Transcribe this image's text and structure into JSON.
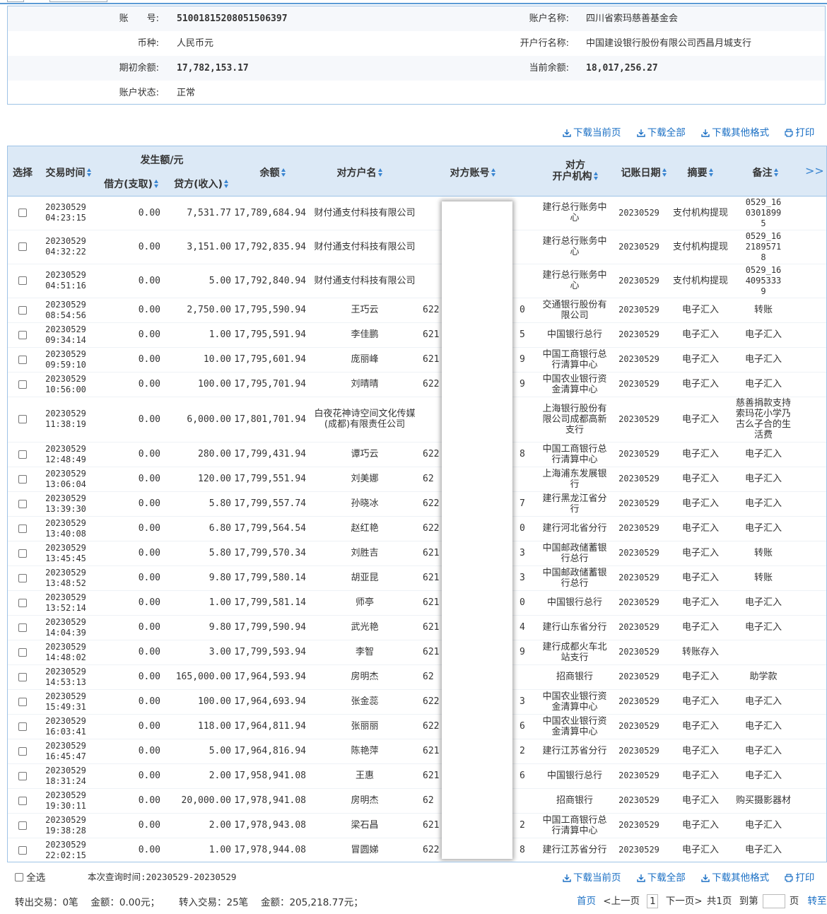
{
  "account": {
    "account_no_label": "账　　号:",
    "account_no": "51001815208051506397",
    "account_name_label": "账户名称:",
    "account_name": "四川省索玛慈善基金会",
    "currency_label": "币种:",
    "currency": "人民币元",
    "bank_label": "开户行名称:",
    "bank": "中国建设银行股份有限公司西昌月城支行",
    "opening_balance_label": "期初余额:",
    "opening_balance": "17,782,153.17",
    "current_balance_label": "当前余额:",
    "current_balance": "18,017,256.27",
    "status_label": "账户状态:",
    "status": "正常"
  },
  "toolbar": {
    "download_current": "下载当前页",
    "download_all": "下载全部",
    "download_other": "下载其他格式",
    "print": "打印"
  },
  "table": {
    "headers": {
      "select": "选择",
      "time": "交易时间",
      "amount_group": "发生额/元",
      "debit": "借方(支取)",
      "credit": "贷方(收入)",
      "balance": "余额",
      "counterparty_name": "对方户名",
      "counterparty_account": "对方账号",
      "counterparty_bank_l1": "对方",
      "counterparty_bank_l2": "开户机构",
      "post_date": "记账日期",
      "summary": "摘要",
      "remark": "备注",
      "more": ">>"
    },
    "rows": [
      {
        "date": "20230529",
        "time": "04:23:15",
        "debit": "0.00",
        "credit": "7,531.77",
        "balance": "17,789,684.94",
        "name": "财付通支付科技有限公司",
        "acct_l": "",
        "acct_r": "",
        "bank": "建行总行账务中心",
        "post": "20230529",
        "summary": "支付机构提现",
        "remark": "0529_1603018995"
      },
      {
        "date": "20230529",
        "time": "04:32:22",
        "debit": "0.00",
        "credit": "3,151.00",
        "balance": "17,792,835.94",
        "name": "财付通支付科技有限公司",
        "acct_l": "",
        "acct_r": "",
        "bank": "建行总行账务中心",
        "post": "20230529",
        "summary": "支付机构提现",
        "remark": "0529_1621895718"
      },
      {
        "date": "20230529",
        "time": "04:51:16",
        "debit": "0.00",
        "credit": "5.00",
        "balance": "17,792,840.94",
        "name": "财付通支付科技有限公司",
        "acct_l": "",
        "acct_r": "",
        "bank": "建行总行账务中心",
        "post": "20230529",
        "summary": "支付机构提现",
        "remark": "0529_1640953339"
      },
      {
        "date": "20230529",
        "time": "08:54:56",
        "debit": "0.00",
        "credit": "2,750.00",
        "balance": "17,795,590.94",
        "name": "王巧云",
        "acct_l": "622",
        "acct_r": "0",
        "bank": "交通银行股份有限公司",
        "post": "20230529",
        "summary": "电子汇入",
        "remark": "转账"
      },
      {
        "date": "20230529",
        "time": "09:34:14",
        "debit": "0.00",
        "credit": "1.00",
        "balance": "17,795,591.94",
        "name": "李佳鹏",
        "acct_l": "621",
        "acct_r": "5",
        "bank": "中国银行总行",
        "post": "20230529",
        "summary": "电子汇入",
        "remark": "电子汇入"
      },
      {
        "date": "20230529",
        "time": "09:59:10",
        "debit": "0.00",
        "credit": "10.00",
        "balance": "17,795,601.94",
        "name": "庞丽峰",
        "acct_l": "621",
        "acct_r": "9",
        "bank": "中国工商银行总行清算中心",
        "post": "20230529",
        "summary": "电子汇入",
        "remark": "电子汇入"
      },
      {
        "date": "20230529",
        "time": "10:56:00",
        "debit": "0.00",
        "credit": "100.00",
        "balance": "17,795,701.94",
        "name": "刘晴晴",
        "acct_l": "622",
        "acct_r": "9",
        "bank": "中国农业银行资金清算中心",
        "post": "20230529",
        "summary": "电子汇入",
        "remark": "电子汇入"
      },
      {
        "date": "20230529",
        "time": "11:38:19",
        "debit": "0.00",
        "credit": "6,000.00",
        "balance": "17,801,701.94",
        "name": "白夜花神诗空间文化传媒(成都)有限责任公司",
        "acct_l": "",
        "acct_r": "",
        "bank": "上海银行股份有限公司成都高新支行",
        "post": "20230529",
        "summary": "电子汇入",
        "remark": "慈善捐款支持索玛花小学乃古么子合的生活费"
      },
      {
        "date": "20230529",
        "time": "12:48:49",
        "debit": "0.00",
        "credit": "280.00",
        "balance": "17,799,431.94",
        "name": "谭巧云",
        "acct_l": "622",
        "acct_r": "8",
        "bank": "中国工商银行总行清算中心",
        "post": "20230529",
        "summary": "电子汇入",
        "remark": "电子汇入"
      },
      {
        "date": "20230529",
        "time": "13:06:04",
        "debit": "0.00",
        "credit": "120.00",
        "balance": "17,799,551.94",
        "name": "刘美娜",
        "acct_l": "62",
        "acct_r": "",
        "bank": "上海浦东发展银行",
        "post": "20230529",
        "summary": "电子汇入",
        "remark": "电子汇入"
      },
      {
        "date": "20230529",
        "time": "13:39:30",
        "debit": "0.00",
        "credit": "5.80",
        "balance": "17,799,557.74",
        "name": "孙晓冰",
        "acct_l": "622",
        "acct_r": "7",
        "bank": "建行黑龙江省分行",
        "post": "20230529",
        "summary": "电子汇入",
        "remark": "电子汇入"
      },
      {
        "date": "20230529",
        "time": "13:40:08",
        "debit": "0.00",
        "credit": "6.80",
        "balance": "17,799,564.54",
        "name": "赵红艳",
        "acct_l": "622",
        "acct_r": "0",
        "bank": "建行河北省分行",
        "post": "20230529",
        "summary": "电子汇入",
        "remark": "电子汇入"
      },
      {
        "date": "20230529",
        "time": "13:45:45",
        "debit": "0.00",
        "credit": "5.80",
        "balance": "17,799,570.34",
        "name": "刘胜吉",
        "acct_l": "621",
        "acct_r": "3",
        "bank": "中国邮政储蓄银行总行",
        "post": "20230529",
        "summary": "电子汇入",
        "remark": "转账"
      },
      {
        "date": "20230529",
        "time": "13:48:52",
        "debit": "0.00",
        "credit": "9.80",
        "balance": "17,799,580.14",
        "name": "胡亚昆",
        "acct_l": "621",
        "acct_r": "3",
        "bank": "中国邮政储蓄银行总行",
        "post": "20230529",
        "summary": "电子汇入",
        "remark": "转账"
      },
      {
        "date": "20230529",
        "time": "13:52:14",
        "debit": "0.00",
        "credit": "1.00",
        "balance": "17,799,581.14",
        "name": "师亭",
        "acct_l": "621",
        "acct_r": "0",
        "bank": "中国银行总行",
        "post": "20230529",
        "summary": "电子汇入",
        "remark": "电子汇入"
      },
      {
        "date": "20230529",
        "time": "14:04:39",
        "debit": "0.00",
        "credit": "9.80",
        "balance": "17,799,590.94",
        "name": "武光艳",
        "acct_l": "621",
        "acct_r": "4",
        "bank": "建行山东省分行",
        "post": "20230529",
        "summary": "电子汇入",
        "remark": "电子汇入"
      },
      {
        "date": "20230529",
        "time": "14:48:02",
        "debit": "0.00",
        "credit": "3.00",
        "balance": "17,799,593.94",
        "name": "李智",
        "acct_l": "621",
        "acct_r": "9",
        "bank": "建行成都火车北站支行",
        "post": "20230529",
        "summary": "转账存入",
        "remark": ""
      },
      {
        "date": "20230529",
        "time": "14:53:13",
        "debit": "0.00",
        "credit": "165,000.00",
        "balance": "17,964,593.94",
        "name": "房明杰",
        "acct_l": "62",
        "acct_r": "",
        "bank": "招商银行",
        "post": "20230529",
        "summary": "电子汇入",
        "remark": "助学款"
      },
      {
        "date": "20230529",
        "time": "15:49:31",
        "debit": "0.00",
        "credit": "100.00",
        "balance": "17,964,693.94",
        "name": "张金蕊",
        "acct_l": "622",
        "acct_r": "3",
        "bank": "中国农业银行资金清算中心",
        "post": "20230529",
        "summary": "电子汇入",
        "remark": "电子汇入"
      },
      {
        "date": "20230529",
        "time": "16:03:41",
        "debit": "0.00",
        "credit": "118.00",
        "balance": "17,964,811.94",
        "name": "张丽丽",
        "acct_l": "622",
        "acct_r": "6",
        "bank": "中国农业银行资金清算中心",
        "post": "20230529",
        "summary": "电子汇入",
        "remark": "电子汇入"
      },
      {
        "date": "20230529",
        "time": "16:45:47",
        "debit": "0.00",
        "credit": "5.00",
        "balance": "17,964,816.94",
        "name": "陈艳萍",
        "acct_l": "621",
        "acct_r": "2",
        "bank": "建行江苏省分行",
        "post": "20230529",
        "summary": "电子汇入",
        "remark": "电子汇入"
      },
      {
        "date": "20230529",
        "time": "18:31:24",
        "debit": "0.00",
        "credit": "2.00",
        "balance": "17,958,941.08",
        "name": "王惠",
        "acct_l": "621",
        "acct_r": "6",
        "bank": "中国银行总行",
        "post": "20230529",
        "summary": "电子汇入",
        "remark": "电子汇入"
      },
      {
        "date": "20230529",
        "time": "19:30:11",
        "debit": "0.00",
        "credit": "20,000.00",
        "balance": "17,978,941.08",
        "name": "房明杰",
        "acct_l": "62",
        "acct_r": "",
        "bank": "招商银行",
        "post": "20230529",
        "summary": "电子汇入",
        "remark": "购买摄影器材"
      },
      {
        "date": "20230529",
        "time": "19:38:28",
        "debit": "0.00",
        "credit": "2.00",
        "balance": "17,978,943.08",
        "name": "梁石昌",
        "acct_l": "621",
        "acct_r": "2",
        "bank": "中国工商银行总行清算中心",
        "post": "20230529",
        "summary": "电子汇入",
        "remark": "电子汇入"
      },
      {
        "date": "20230529",
        "time": "22:02:15",
        "debit": "0.00",
        "credit": "1.00",
        "balance": "17,978,944.08",
        "name": "冒圆娣",
        "acct_l": "622",
        "acct_r": "8",
        "bank": "建行江苏省分行",
        "post": "20230529",
        "summary": "电子汇入",
        "remark": "电子汇入"
      }
    ]
  },
  "footer": {
    "select_all": "全选",
    "query_time": "本次查询时间:20230529-20230529",
    "out_summary": "转出交易：0笔　 金额：0.00元；",
    "in_summary": "转入交易：25笔　 金额：205,218.77元；",
    "first": "首页",
    "prev": "<上一页",
    "page": "1",
    "next": "下一页>",
    "total": "共1页",
    "goto_label": "到第",
    "page_unit": "页",
    "go": "转至"
  }
}
